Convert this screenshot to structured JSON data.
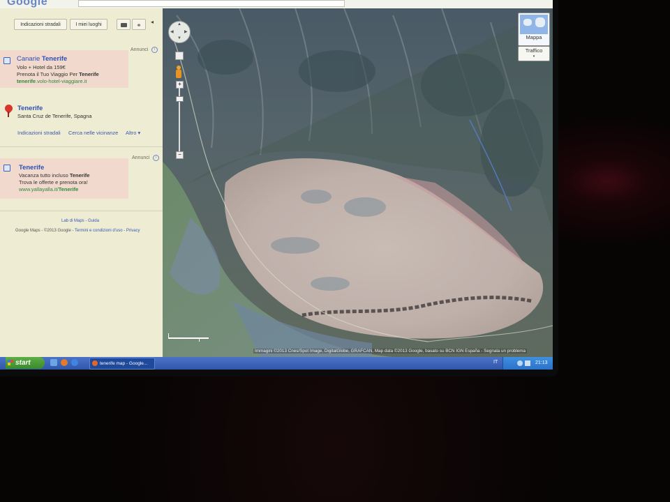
{
  "browser": {
    "logo_text": "Google",
    "search_query": ""
  },
  "sidebar": {
    "directions_button": "Indicazioni stradali",
    "my_places_button": "I miei luoghi",
    "collapse_arrow": "◂",
    "ads_label_top": "Annunci",
    "ad1": {
      "title_prefix": "Canarie ",
      "title_bold": "Tenerife",
      "line1": "Volo + Hotel da 159€",
      "line2_prefix": "Prenota il Tuo Viaggio Per ",
      "line2_bold": "Tenerife",
      "url_bold": "tenerife",
      "url_rest": ".volo-hotel-viaggiare.it"
    },
    "result": {
      "title": "Tenerife",
      "address": "Santa Cruz de Tenerife, Spagna",
      "link_directions": "Indicazioni stradali",
      "link_search_nearby": "Cerca nelle vicinanze",
      "link_more": "Altro"
    },
    "ads_label_bottom": "Annunci",
    "ad2": {
      "title": "Tenerife",
      "line1_prefix": "Vacanza tutto incluso ",
      "line1_bold": "Tenerife",
      "line2": "Trova le offerte e prenota ora!",
      "url_prefix": "www.yallayalla.it/",
      "url_bold": "Tenerife"
    },
    "footer_links": "Lab di Maps - Guida",
    "footer_legal_prefix": "Google Maps - ©2013 Google - ",
    "footer_legal_links": "Termini e condizioni d'uso - Privacy"
  },
  "map": {
    "map_button": "Mappa",
    "traffic_button": "Traffico",
    "attribution": "Immagini ©2013 Cnes/Spot Image, DigitalGlobe, GRAFCAN, Map data ©2013 Google, basato su BCN IGN España - ",
    "report_problem": "Segnala un problema"
  },
  "taskbar": {
    "start_label": "start",
    "task_label": "tenerife map - Google...",
    "clock": "21:13",
    "lang": "IT"
  }
}
